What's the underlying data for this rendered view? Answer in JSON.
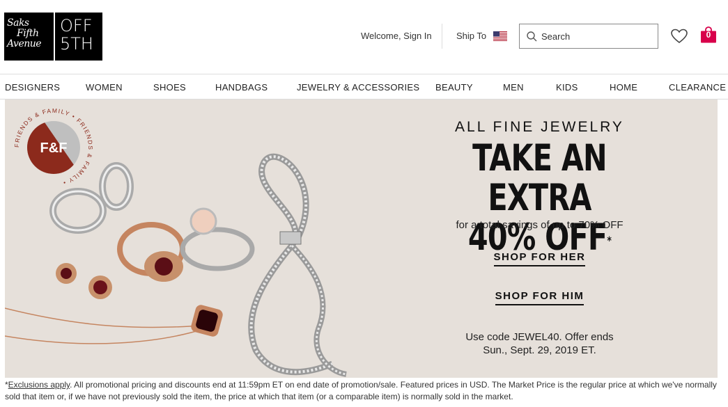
{
  "logo": {
    "saks_line1": "Saks",
    "saks_line2": "Fifth",
    "saks_line3": "Avenue",
    "off_line1": "OFF",
    "off_line2": "5TH"
  },
  "header": {
    "welcome": "Welcome, Sign In",
    "ship_to": "Ship To",
    "search_placeholder": "Search",
    "bag_count": "0",
    "bag_color": "#d8004b"
  },
  "nav": [
    "DESIGNERS",
    "WOMEN",
    "SHOES",
    "HANDBAGS",
    "JEWELRY & ACCESSORIES",
    "BEAUTY",
    "MEN",
    "KIDS",
    "HOME",
    "CLEARANCE"
  ],
  "hero": {
    "badge_text": "F&F",
    "badge_ring": "FRIENDS & FAMILY • FRIENDS & FAMILY •",
    "pre": "ALL FINE JEWELRY",
    "line1": "TAKE AN EXTRA",
    "line2": "40% OFF",
    "asterisk": "*",
    "sub": "for a total savings of up to 70% OFF",
    "cta_her": "SHOP FOR HER",
    "cta_him": "SHOP FOR HIM",
    "code_line1": "Use code JEWEL40. Offer ends",
    "code_line2": "Sun., Sept. 29, 2019 ET."
  },
  "disclaimer": {
    "prefix": "*",
    "link": "Exclusions apply",
    "text": ". All promotional pricing and discounts end at 11:59pm ET on end date of promotion/sale. Featured prices in USD. The Market Price is the regular price at which we've normally sold that item or, if we have not previously sold the item, the price at which that item (or a comparable item) is normally sold in the market."
  }
}
